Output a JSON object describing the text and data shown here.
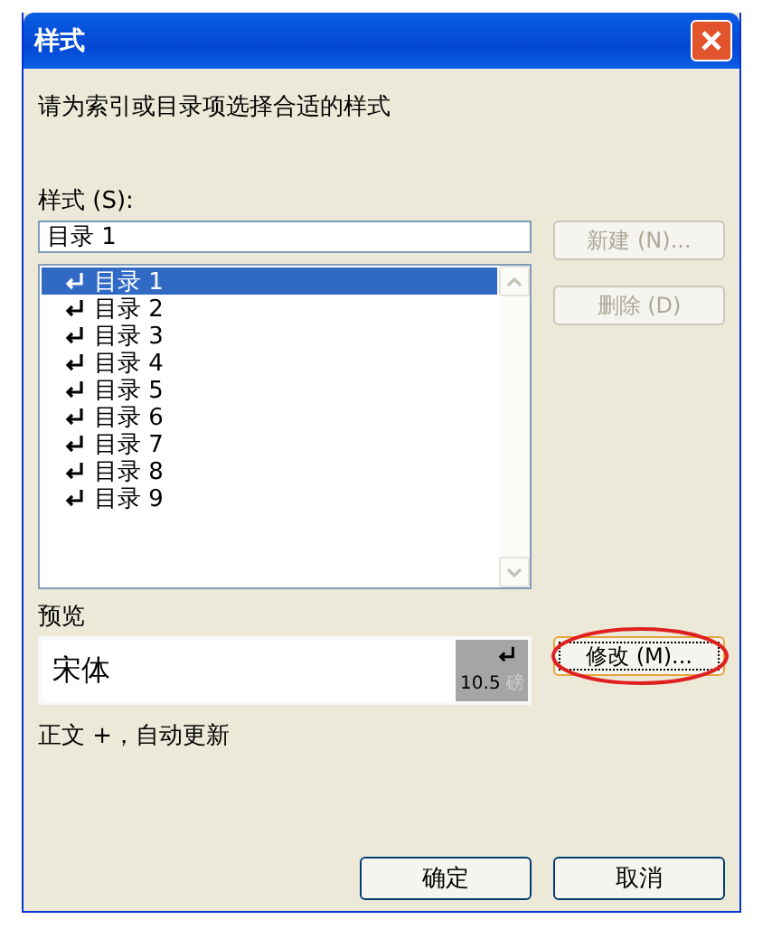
{
  "window": {
    "title": "样式"
  },
  "instruction": "请为索引或目录项选择合适的样式",
  "styles_label": "样式 (S):",
  "style_field": {
    "value": "目录 1"
  },
  "style_list": [
    {
      "label": "目录 1",
      "selected": true
    },
    {
      "label": "目录 2",
      "selected": false
    },
    {
      "label": "目录 3",
      "selected": false
    },
    {
      "label": "目录 4",
      "selected": false
    },
    {
      "label": "目录 5",
      "selected": false
    },
    {
      "label": "目录 6",
      "selected": false
    },
    {
      "label": "目录 7",
      "selected": false
    },
    {
      "label": "目录 8",
      "selected": false
    },
    {
      "label": "目录 9",
      "selected": false
    }
  ],
  "side_buttons": [
    {
      "label": "新建 (N)...",
      "disabled": true
    },
    {
      "label": "删除 (D)",
      "disabled": true
    }
  ],
  "preview": {
    "label": "预览",
    "font_sample": "宋体",
    "size": "10.5",
    "unit": "磅"
  },
  "modify_button": {
    "label": "修改 (M)...",
    "focused": true,
    "highlighted": true
  },
  "description": "正文 +，自动更新",
  "buttons": [
    "确定",
    "取消"
  ]
}
